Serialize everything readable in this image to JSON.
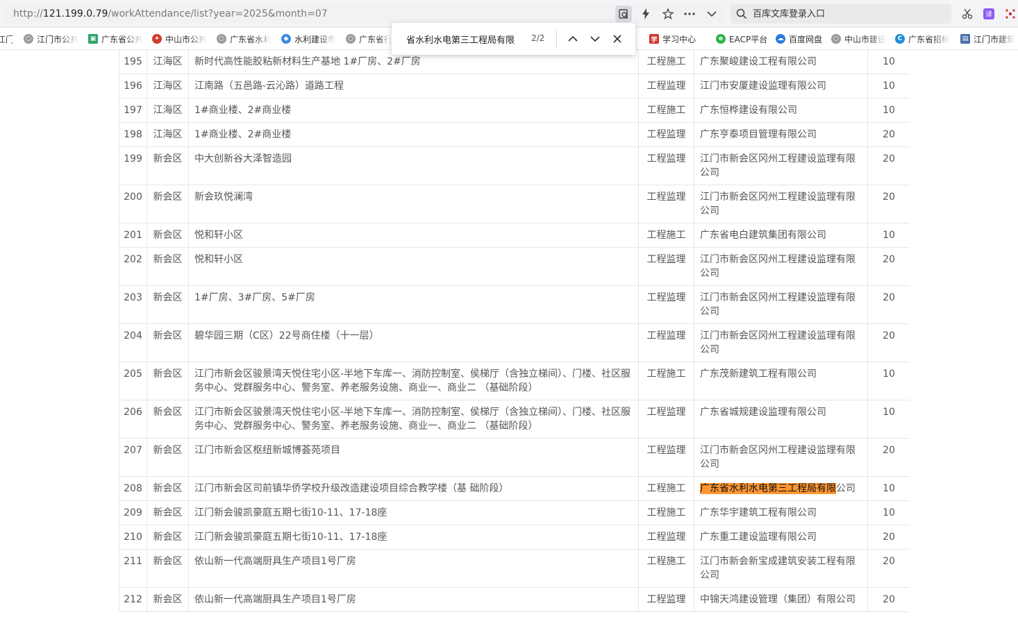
{
  "browser": {
    "url_prefix": "http://",
    "url_host": "121.199.0.79",
    "url_path": "/workAttendance/list?year=2025&month=07",
    "search_placeholder": "百库文库登录入口"
  },
  "bookmarks": [
    {
      "label": "江门",
      "icon": "globe-icon",
      "color": "#8a8a8a"
    },
    {
      "label": "江门市公共",
      "icon": "globe-icon",
      "color": "#8a8a8a"
    },
    {
      "label": "广东省公共",
      "icon": "building-icon",
      "color": "#2aa56a"
    },
    {
      "label": "中山市公共",
      "icon": "gov-emblem-icon",
      "color": "#d23b2c"
    },
    {
      "label": "广东省水利",
      "icon": "globe-icon",
      "color": "#8a8a8a"
    },
    {
      "label": "水利建设市",
      "icon": "water-drop-icon",
      "color": "#3b8be0"
    },
    {
      "label": "广东省行",
      "icon": "globe-icon",
      "color": "#8a8a8a"
    },
    {
      "label": "学习中心",
      "icon": "study-icon",
      "color": "#d0342c"
    },
    {
      "label": "EACP平台",
      "icon": "eacp-icon",
      "color": "#2db34a"
    },
    {
      "label": "百度网盘",
      "icon": "cloud-icon",
      "color": "#2a7de1"
    },
    {
      "label": "中山市建设",
      "icon": "globe-icon",
      "color": "#8a8a8a"
    },
    {
      "label": "广东省招标",
      "icon": "letter-c-icon",
      "color": "#1e8fd6"
    },
    {
      "label": "江门市建筑",
      "icon": "doc-icon",
      "color": "#4b6fa8"
    }
  ],
  "find": {
    "query": "省水利水电第三工程局有限",
    "count": "2/2"
  },
  "rows": [
    {
      "no": "195",
      "district": "江海区",
      "project": "新时代高性能胶粘新材料生产基地 1#厂房、2#厂房",
      "type": "工程施工",
      "company": "广东聚峻建设工程有限公司",
      "score": "10"
    },
    {
      "no": "196",
      "district": "江海区",
      "project": "江南路（五邑路-云沁路）道路工程",
      "type": "工程监理",
      "company": "江门市安厦建设监理有限公司",
      "score": "10"
    },
    {
      "no": "197",
      "district": "江海区",
      "project": "1#商业楼、2#商业楼",
      "type": "工程施工",
      "company": "广东恒桦建设有限公司",
      "score": "10"
    },
    {
      "no": "198",
      "district": "江海区",
      "project": "1#商业楼、2#商业楼",
      "type": "工程监理",
      "company": "广东亨泰项目管理有限公司",
      "score": "20"
    },
    {
      "no": "199",
      "district": "新会区",
      "project": "中大创新谷大泽智造园",
      "type": "工程监理",
      "company": "江门市新会区冈州工程建设监理有限公司",
      "score": "20"
    },
    {
      "no": "200",
      "district": "新会区",
      "project": "新会玖悦澜湾",
      "type": "工程监理",
      "company": "江门市新会区冈州工程建设监理有限公司",
      "score": "20"
    },
    {
      "no": "201",
      "district": "新会区",
      "project": "悦和轩小区",
      "type": "工程施工",
      "company": "广东省电白建筑集团有限公司",
      "score": "10"
    },
    {
      "no": "202",
      "district": "新会区",
      "project": "悦和轩小区",
      "type": "工程监理",
      "company": "江门市新会区冈州工程建设监理有限公司",
      "score": "20"
    },
    {
      "no": "203",
      "district": "新会区",
      "project": "1#厂房、3#厂房、5#厂房",
      "type": "工程监理",
      "company": "江门市新会区冈州工程建设监理有限公司",
      "score": "20"
    },
    {
      "no": "204",
      "district": "新会区",
      "project": "碧华园三期（C区）22号商住楼（十一层）",
      "type": "工程监理",
      "company": "江门市新会区冈州工程建设监理有限公司",
      "score": "20"
    },
    {
      "no": "205",
      "district": "新会区",
      "project": "江门市新会区骏景湾天悦住宅小区-半地下车库一、消防控制室、侯梯厅（含独立梯间）、门楼、社区服 务中心、党群服务中心、警务室、养老服务设施、商业一、商业二 （基础阶段）",
      "type": "工程施工",
      "company": "广东茂新建筑工程有限公司",
      "score": "10"
    },
    {
      "no": "206",
      "district": "新会区",
      "project": "江门市新会区骏景湾天悦住宅小区-半地下车库一、消防控制室、侯梯厅（含独立梯间）、门楼、社区服 务中心、党群服务中心、警务室、养老服务设施、商业一、商业二 （基础阶段）",
      "type": "工程监理",
      "company": "广东省城规建设监理有限公司",
      "score": "10"
    },
    {
      "no": "207",
      "district": "新会区",
      "project": "江门市新会区枢纽新城博荟苑项目",
      "type": "工程监理",
      "company": "江门市新会区冈州工程建设监理有限公司",
      "score": "20"
    },
    {
      "no": "208",
      "district": "新会区",
      "project": "江门市新会区司前镇华侨学校升级改造建设项目综合教学楼（基 础阶段）",
      "type": "工程施工",
      "company": "广东省水利水电第三工程局有限公司",
      "score": "10",
      "highlight": "广东省水利水电第三工程局有限"
    },
    {
      "no": "209",
      "district": "新会区",
      "project": "江门新会骏凯豪庭五期七街10-11、17-18座",
      "type": "工程施工",
      "company": "广东华宇建筑工程有限公司",
      "score": "10"
    },
    {
      "no": "210",
      "district": "新会区",
      "project": "江门新会骏凯豪庭五期七街10-11、17-18座",
      "type": "工程监理",
      "company": "广东重工建设监理有限公司",
      "score": "20"
    },
    {
      "no": "211",
      "district": "新会区",
      "project": "依山新一代高端厨具生产项目1号厂房",
      "type": "工程施工",
      "company": "江门市新会新宝成建筑安装工程有限公司",
      "score": "20"
    },
    {
      "no": "212",
      "district": "新会区",
      "project": "依山新一代高端厨具生产项目1号厂房",
      "type": "工程监理",
      "company": "中锦天鸿建设管理（集团）有限公司",
      "score": "20"
    }
  ]
}
